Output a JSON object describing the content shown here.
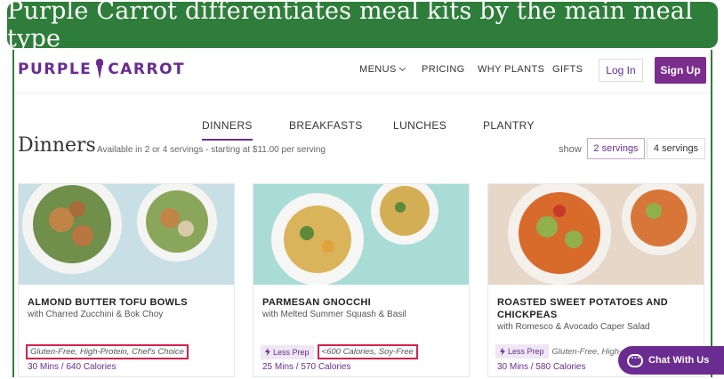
{
  "banner": {
    "text": "Purple Carrot differentiates meal kits by the main meal type"
  },
  "header": {
    "logo_left": "PURPLE",
    "logo_right": "CARROT",
    "nav": [
      "MENUS",
      "PRICING",
      "WHY PLANTS",
      "GIFTS"
    ],
    "login": "Log In",
    "signup": "Sign Up"
  },
  "tabs": [
    "DINNERS",
    "BREAKFASTS",
    "LUNCHES",
    "PLANTRY"
  ],
  "page": {
    "title": "Dinners",
    "subtitle": "Available in 2 or 4 servings - starting at $11.00 per serving",
    "show_label": "show",
    "servings": [
      "2 servings",
      "4 servings"
    ]
  },
  "cards": [
    {
      "name": "ALMOND BUTTER TOFU BOWLS",
      "sub": "with Charred Zucchini & Bok Choy",
      "tags": "Gluten-Free, High-Protein, Chef's Choice",
      "time": "30 Mins / 640 Calories"
    },
    {
      "name": "PARMESAN GNOCCHI",
      "sub": "with Melted Summer Squash & Basil",
      "less_prep": "Less Prep",
      "tags": "<600 Calories, Soy-Free",
      "time": "25 Mins / 570 Calories"
    },
    {
      "name": "ROASTED SWEET POTATOES AND CHICKPEAS",
      "sub": "with Romesco & Avocado Caper Salad",
      "less_prep": "Less Prep",
      "tags": "Gluten-Free, High-",
      "time": "30 Mins / 580 Calories"
    }
  ],
  "chat": {
    "label": "Chat With Us"
  },
  "colors": {
    "brand": "#6a2c91",
    "banner": "#2f7d3a",
    "highlight": "#d62050"
  }
}
